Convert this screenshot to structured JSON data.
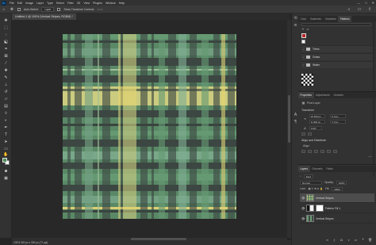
{
  "app": {
    "logo": "Ps",
    "menu": [
      "File",
      "Edit",
      "Image",
      "Layer",
      "Type",
      "Select",
      "Filter",
      "3D",
      "View",
      "Plugins",
      "Window",
      "Help"
    ],
    "window_controls": [
      "—",
      "□",
      "✕"
    ]
  },
  "options_bar": {
    "auto_select_label": "Auto-Select:",
    "layer_select": "Layer",
    "transform_label": "Show Transform Controls",
    "dots": "• • •"
  },
  "document": {
    "tab_label": "Untitled-1 @ 100% (Vertical Stripes, RGB/8) *"
  },
  "status": {
    "text": "100%    300 px x 300 px (72 ppi)"
  },
  "colors": {
    "foreground": "#4f8f5c",
    "background": "#ffffff",
    "accent": "#31a8ff"
  },
  "panels": {
    "top_tabs": [
      "Color",
      "Swatches",
      "Gradients",
      "Patterns"
    ],
    "patterns_folders": [
      "Trees",
      "Grass",
      "Water"
    ],
    "properties_tabs": [
      "Properties",
      "Adjustments",
      "Libraries"
    ],
    "properties": {
      "section": "Pixel Layer",
      "transform_label": "Transform",
      "w": "W  300 px",
      "h": "H  300 px",
      "x": "X  0 px",
      "y": "Y  0 px",
      "angle": "0.00°",
      "align_label": "Align and Distribute",
      "align_sub": "Align:"
    },
    "layers_tabs": [
      "Layers",
      "Channels",
      "Paths"
    ],
    "layers": {
      "kind": "Kind",
      "blend_mode": "Normal",
      "opacity_label": "Opacity:",
      "opacity": "100%",
      "lock_label": "Lock:",
      "fill_label": "Fill:",
      "fill": "100%",
      "items": [
        "Vertical Stripes",
        "Pattern Fill 1",
        "Vertical Stripes"
      ]
    }
  }
}
